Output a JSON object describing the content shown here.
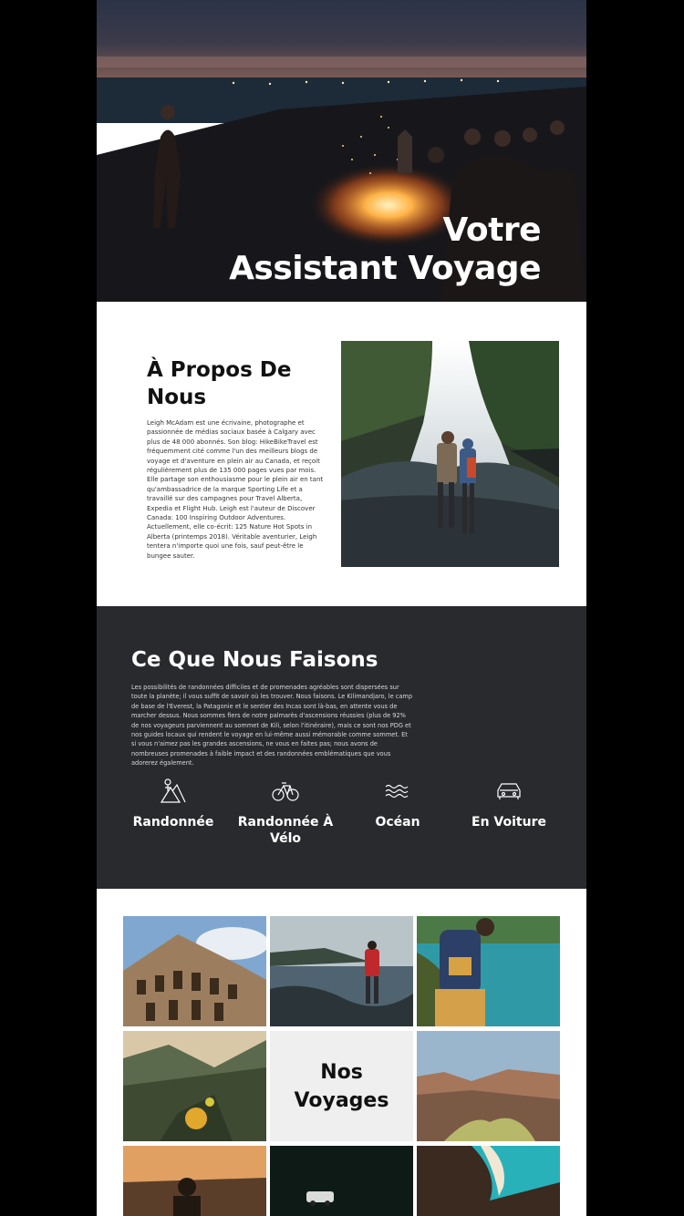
{
  "hero": {
    "title_line1": "Votre",
    "title_line2": "Assistant Voyage"
  },
  "about": {
    "title": "À Propos De Nous",
    "text": "Leigh McAdam est une écrivaine, photographe et passionnée de médias sociaux basée à Calgary avec plus de 48 000 abonnés. Son blog: HikeBikeTravel est fréquemment cité comme l'un des meilleurs blogs de voyage et d'aventure en plein air au Canada, et reçoit régulièrement plus de 135 000 pages vues par mois. Elle partage son enthousiasme pour le plein air en tant qu'ambassadrice de la marque Sporting Life et a travaillé sur des campagnes pour Travel Alberta, Expedia et Flight Hub. Leigh est l'auteur de Discover Canada: 100 Inspiring Outdoor Adventures. Actuellement, elle co-écrit: 125 Nature Hot Spots in Alberta (printemps 2018). Véritable aventurier, Leigh tentera n'importe quoi une fois, sauf peut-être le bungee sauter."
  },
  "what_we_do": {
    "title": "Ce Que Nous Faisons",
    "text": "Les possibilités de randonnées difficiles et de promenades agréables sont dispersées sur toute la planète; il vous suffit de savoir où les trouver. Nous faisons. Le Kilimandjaro, le camp de base de l'Everest, la Patagonie et le sentier des Incas sont là-bas, en attente vous de marcher dessus. Nous sommes fiers de notre palmarès d'ascensions réussies (plus de 92% de nos voyageurs parviennent au sommet de Kili, selon l'itinéraire), mais ce sont nos PDG et nos guides locaux qui rendent le voyage en lui-même aussi mémorable comme sommet. Et si vous n'aimez pas les grandes ascensions, ne vous en faites pas; nous avons de nombreuses promenades à faible impact et des randonnées emblématiques que vous adorerez également.",
    "activities": [
      {
        "icon": "mountain-hiking-icon",
        "label": "Randonnée"
      },
      {
        "icon": "bicycle-icon",
        "label": "Randonnée À Vélo"
      },
      {
        "icon": "waves-icon",
        "label": "Océan"
      },
      {
        "icon": "car-icon",
        "label": "En Voiture"
      }
    ]
  },
  "gallery": {
    "title": "Nos Voyages"
  },
  "colors": {
    "dark_section": "#292a2e",
    "page_background": "#ffffff",
    "outer_background": "#000000"
  }
}
